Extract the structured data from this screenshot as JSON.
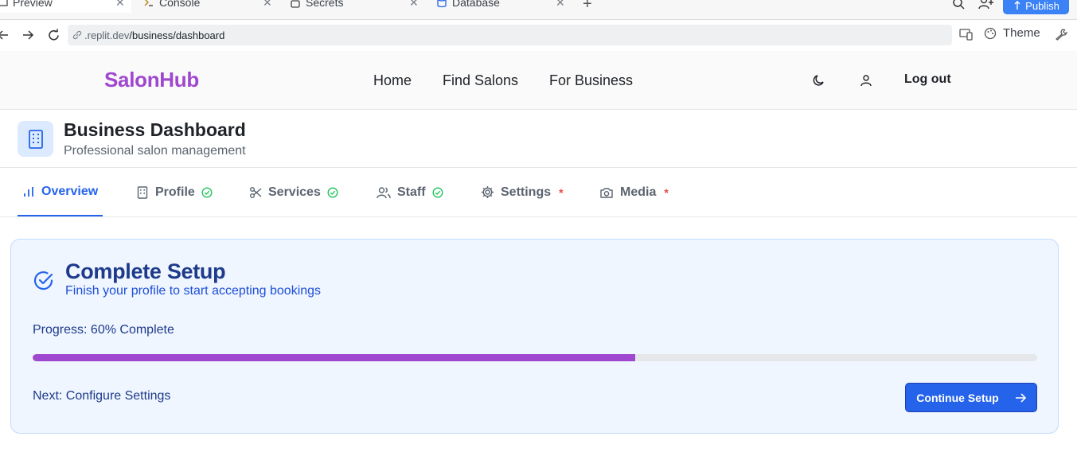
{
  "ide_tabs": [
    {
      "label": "Preview",
      "icon": "preview-icon",
      "active": true
    },
    {
      "label": "Console",
      "icon": "terminal-icon",
      "active": false
    },
    {
      "label": "Secrets",
      "icon": "lock-icon",
      "active": false
    },
    {
      "label": "Database",
      "icon": "database-icon",
      "active": false
    }
  ],
  "ide_actions": {
    "publish_label": "Publish"
  },
  "browser": {
    "url_host": ".replit.dev",
    "url_path": "/business/dashboard",
    "theme_label": "Theme"
  },
  "header": {
    "brand": "SalonHub",
    "nav": [
      "Home",
      "Find Salons",
      "For Business"
    ],
    "logout_label": "Log out"
  },
  "page": {
    "title": "Business Dashboard",
    "subtitle": "Professional salon management"
  },
  "tabs": [
    {
      "label": "Overview",
      "icon": "bar-chart-icon",
      "status": "none",
      "active": true
    },
    {
      "label": "Profile",
      "icon": "building-icon",
      "status": "complete",
      "active": false
    },
    {
      "label": "Services",
      "icon": "scissors-icon",
      "status": "complete",
      "active": false
    },
    {
      "label": "Staff",
      "icon": "users-icon",
      "status": "complete",
      "active": false
    },
    {
      "label": "Settings",
      "icon": "gear-icon",
      "status": "required",
      "active": false
    },
    {
      "label": "Media",
      "icon": "camera-icon",
      "status": "required",
      "active": false
    }
  ],
  "setup": {
    "title": "Complete Setup",
    "subtitle": "Finish your profile to start accepting bookings",
    "progress_label": "Progress: 60% Complete",
    "progress_value": 0.6,
    "next_label": "Next: Configure Settings",
    "continue_label": "Continue Setup"
  },
  "colors": {
    "brand": "#a047cf",
    "primary": "#2563eb",
    "success": "#22c55e",
    "required": "#ef4444"
  }
}
